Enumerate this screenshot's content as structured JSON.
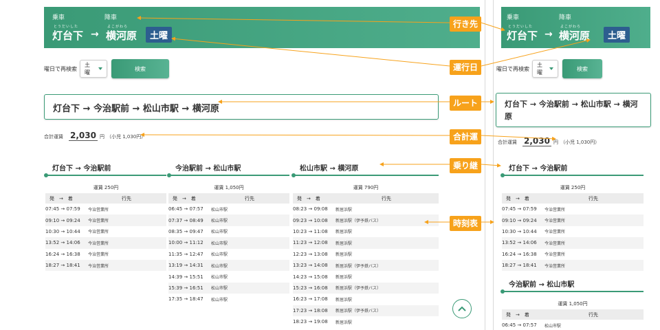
{
  "header": {
    "board_label": "乗車",
    "alight_label": "降車",
    "from_ruby": "とうだいした",
    "from_station": "灯台下",
    "arrow": "→",
    "to_ruby": "よこがわら",
    "to_station": "横河原",
    "day_badge": "土曜"
  },
  "search": {
    "label": "曜日で再検索",
    "selected_day": "土曜",
    "button_label": "検索"
  },
  "route": {
    "left_text": "灯台下 → 今治駅前 → 松山市駅 → 横河原",
    "right_line1": "灯台下 → 今治駅前 → 松山市駅 → 横河",
    "right_line2": "原"
  },
  "fare": {
    "label": "合計運賃",
    "amount": "2,030",
    "yen": "円",
    "child": "（小児 1,030円）"
  },
  "timetable_header": {
    "col_times": "発　→　着",
    "col_dest": "行先"
  },
  "segments": [
    {
      "title": "灯台下 → 今治駅前",
      "fare": "運賃 250円",
      "rows": [
        {
          "time": "07:45 → 07:59",
          "dest": "今治営業所"
        },
        {
          "time": "09:10 → 09:24",
          "dest": "今治営業所"
        },
        {
          "time": "10:30 → 10:44",
          "dest": "今治営業所"
        },
        {
          "time": "13:52 → 14:06",
          "dest": "今治営業所"
        },
        {
          "time": "16:24 → 16:38",
          "dest": "今治営業所"
        },
        {
          "time": "18:27 → 18:41",
          "dest": "今治営業所"
        }
      ]
    },
    {
      "title": "今治駅前 → 松山市駅",
      "fare": "運賃 1,050円",
      "rows": [
        {
          "time": "06:45 → 07:57",
          "dest": "松山市駅"
        },
        {
          "time": "07:37 → 08:49",
          "dest": "松山市駅"
        },
        {
          "time": "08:35 → 09:47",
          "dest": "松山市駅"
        },
        {
          "time": "10:00 → 11:12",
          "dest": "松山市駅"
        },
        {
          "time": "11:35 → 12:47",
          "dest": "松山市駅"
        },
        {
          "time": "13:19 → 14:31",
          "dest": "松山市駅"
        },
        {
          "time": "14:39 → 15:51",
          "dest": "松山市駅"
        },
        {
          "time": "15:39 → 16:51",
          "dest": "松山市駅"
        },
        {
          "time": "17:35 → 18:47",
          "dest": "松山市駅"
        }
      ]
    },
    {
      "title": "松山市駅 → 横河原",
      "fare": "運賃 790円",
      "rows": [
        {
          "time": "08:23 → 09:08",
          "dest": "新居浜駅"
        },
        {
          "time": "09:23 → 10:08",
          "dest": "新居浜駅（伊予鉄バス）"
        },
        {
          "time": "10:23 → 11:08",
          "dest": "新居浜駅"
        },
        {
          "time": "11:23 → 12:08",
          "dest": "新居浜駅"
        },
        {
          "time": "12:23 → 13:08",
          "dest": "新居浜駅"
        },
        {
          "time": "13:23 → 14:08",
          "dest": "新居浜駅（伊予鉄バス）"
        },
        {
          "time": "14:23 → 15:08",
          "dest": "新居浜駅"
        },
        {
          "time": "15:23 → 16:08",
          "dest": "新居浜駅（伊予鉄バス）"
        },
        {
          "time": "16:23 → 17:08",
          "dest": "新居浜駅"
        },
        {
          "time": "17:23 → 18:08",
          "dest": "新居浜駅（伊予鉄バス）"
        },
        {
          "time": "18:23 → 19:08",
          "dest": "新居浜駅"
        }
      ]
    }
  ],
  "callouts": {
    "destination": "行き先",
    "operating_day": "運行日",
    "route": "ルート",
    "total_fare": "合計運賃",
    "transfer": "乗り継ぎ",
    "timetable": "時刻表"
  },
  "colors": {
    "accent_green": "#3a9a76",
    "badge_blue": "#2d5e8f",
    "callout_orange": "#f7a21b"
  },
  "icons": {
    "scroll_top": "chevron-up-icon",
    "dropdown": "caret-down-icon"
  }
}
